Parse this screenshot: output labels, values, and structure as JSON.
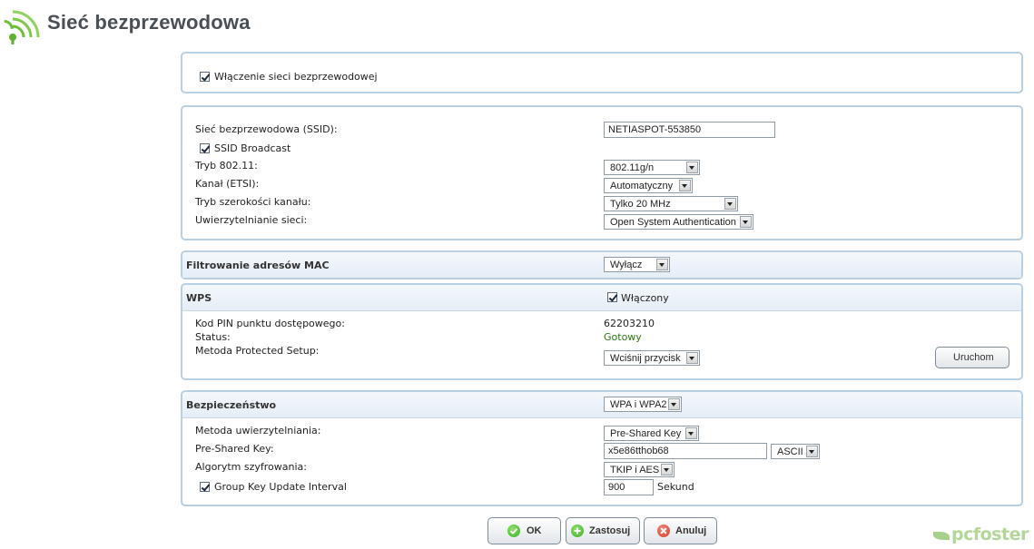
{
  "header": {
    "title": "Sieć bezprzewodowa",
    "icon": "wireless-signal-icon"
  },
  "enable_section": {
    "label": "Włączenie sieci bezprzewodowej",
    "checked": true
  },
  "wireless": {
    "ssid_label": "Sieć bezprzewodowa (SSID):",
    "ssid_value": "NETIASPOT-553850",
    "broadcast_label": "SSID Broadcast",
    "broadcast_checked": true,
    "mode_label": "Tryb 802.11:",
    "mode_value": "802.11g/n",
    "channel_label": "Kanał (ETSI):",
    "channel_value": "Automatyczny",
    "width_label": "Tryb szerokości kanału:",
    "width_value": "Tylko 20 MHz",
    "auth_label": "Uwierzytelnianie sieci:",
    "auth_value": "Open System Authentication"
  },
  "mac_filter": {
    "label": "Filtrowanie adresów MAC",
    "value": "Wyłącz"
  },
  "wps": {
    "label": "WPS",
    "enabled_label": "Włączony",
    "enabled_checked": true,
    "pin_label": "Kod PIN punktu dostępowego:",
    "pin_value": "62203210",
    "status_label": "Status:",
    "status_value": "Gotowy",
    "method_label": "Metoda Protected Setup:",
    "method_value": "Wciśnij przycisk",
    "run_button": "Uruchom"
  },
  "security": {
    "label": "Bezpieczeństwo",
    "value": "WPA i WPA2",
    "auth_method_label": "Metoda uwierzytelniania:",
    "auth_method_value": "Pre-Shared Key",
    "psk_label": "Pre-Shared Key:",
    "psk_value": "x5e86tthob68",
    "psk_format": "ASCII",
    "algo_label": "Algorytm szyfrowania:",
    "algo_value": "TKIP i AES",
    "gkui_label": "Group Key Update Interval",
    "gkui_checked": true,
    "gkui_value": "900",
    "gkui_unit": "Sekund"
  },
  "buttons": {
    "ok": "OK",
    "apply": "Zastosuj",
    "cancel": "Anuluj"
  },
  "watermark": {
    "text": "pcfoster"
  },
  "colors": {
    "panel_border": "#b9cfe2",
    "status_green": "#2a7a12",
    "ok_green": "#3fae2a",
    "cancel_red": "#d63a2b"
  }
}
